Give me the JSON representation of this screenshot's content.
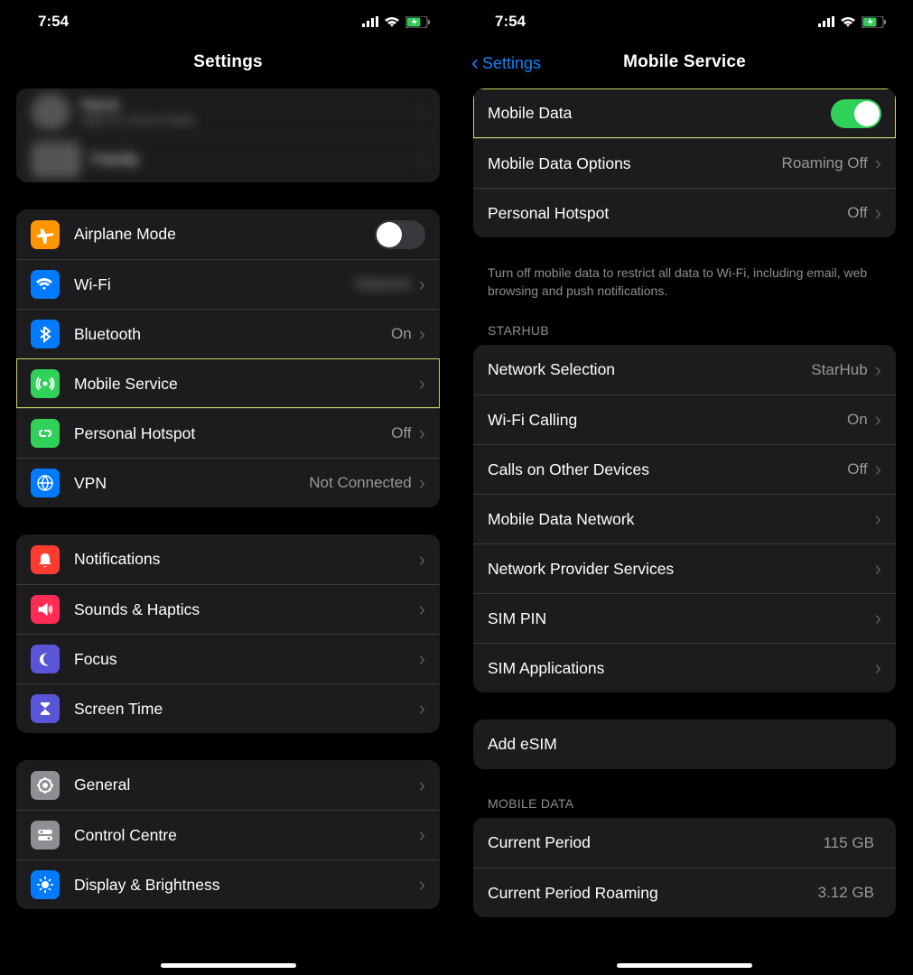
{
  "status": {
    "time": "7:54"
  },
  "left": {
    "title": "Settings",
    "profile": {
      "line1": "Name",
      "line2": "Apple ID, iCloud, Media"
    },
    "family": "Family",
    "items": [
      {
        "id": "airplane",
        "label": "Airplane Mode",
        "value": "",
        "toggle": "off",
        "color": "#ff9500"
      },
      {
        "id": "wifi",
        "label": "Wi-Fi",
        "value": "Network",
        "color": "#007aff"
      },
      {
        "id": "bt",
        "label": "Bluetooth",
        "value": "On",
        "color": "#007aff"
      },
      {
        "id": "mobile",
        "label": "Mobile Service",
        "value": "",
        "color": "#30d158",
        "highlight": true
      },
      {
        "id": "hotspot",
        "label": "Personal Hotspot",
        "value": "Off",
        "color": "#30d158"
      },
      {
        "id": "vpn",
        "label": "VPN",
        "value": "Not Connected",
        "color": "#007aff"
      }
    ],
    "items2": [
      {
        "id": "notif",
        "label": "Notifications",
        "color": "#ff3b30"
      },
      {
        "id": "sounds",
        "label": "Sounds & Haptics",
        "color": "#ff2d55"
      },
      {
        "id": "focus",
        "label": "Focus",
        "color": "#5856d6"
      },
      {
        "id": "screen",
        "label": "Screen Time",
        "color": "#5856d6"
      }
    ],
    "items3": [
      {
        "id": "general",
        "label": "General",
        "color": "#8e8e93"
      },
      {
        "id": "control",
        "label": "Control Centre",
        "color": "#8e8e93"
      },
      {
        "id": "display",
        "label": "Display & Brightness",
        "color": "#007aff"
      }
    ]
  },
  "right": {
    "back": "Settings",
    "title": "Mobile Service",
    "group1": [
      {
        "id": "mdata",
        "label": "Mobile Data",
        "toggle": "on",
        "highlight": true
      },
      {
        "id": "mopts",
        "label": "Mobile Data Options",
        "value": "Roaming Off"
      },
      {
        "id": "photsp",
        "label": "Personal Hotspot",
        "value": "Off"
      }
    ],
    "note": "Turn off mobile data to restrict all data to Wi-Fi, including email, web browsing and push notifications.",
    "header2": "STARHUB",
    "group2": [
      {
        "id": "netsel",
        "label": "Network Selection",
        "value": "StarHub"
      },
      {
        "id": "wificall",
        "label": "Wi-Fi Calling",
        "value": "On"
      },
      {
        "id": "callsod",
        "label": "Calls on Other Devices",
        "value": "Off"
      },
      {
        "id": "mdnet",
        "label": "Mobile Data Network",
        "value": ""
      },
      {
        "id": "nps",
        "label": "Network Provider Services",
        "value": ""
      },
      {
        "id": "simpin",
        "label": "SIM PIN",
        "value": ""
      },
      {
        "id": "simapp",
        "label": "SIM Applications",
        "value": ""
      }
    ],
    "group3": [
      {
        "id": "addesim",
        "label": "Add eSIM"
      }
    ],
    "header3": "MOBILE DATA",
    "group4": [
      {
        "id": "curper",
        "label": "Current Period",
        "value": "115 GB"
      },
      {
        "id": "curroam",
        "label": "Current Period Roaming",
        "value": "3.12 GB"
      }
    ]
  },
  "icons": {
    "airplane": "airplane-icon",
    "wifi": "wifi-icon",
    "bt": "bluetooth-icon",
    "mobile": "antenna-icon",
    "hotspot": "link-icon",
    "vpn": "globe-icon",
    "notif": "bell-icon",
    "sounds": "speaker-icon",
    "focus": "moon-icon",
    "screen": "hourglass-icon",
    "general": "gear-icon",
    "control": "switches-icon",
    "display": "sun-icon"
  }
}
